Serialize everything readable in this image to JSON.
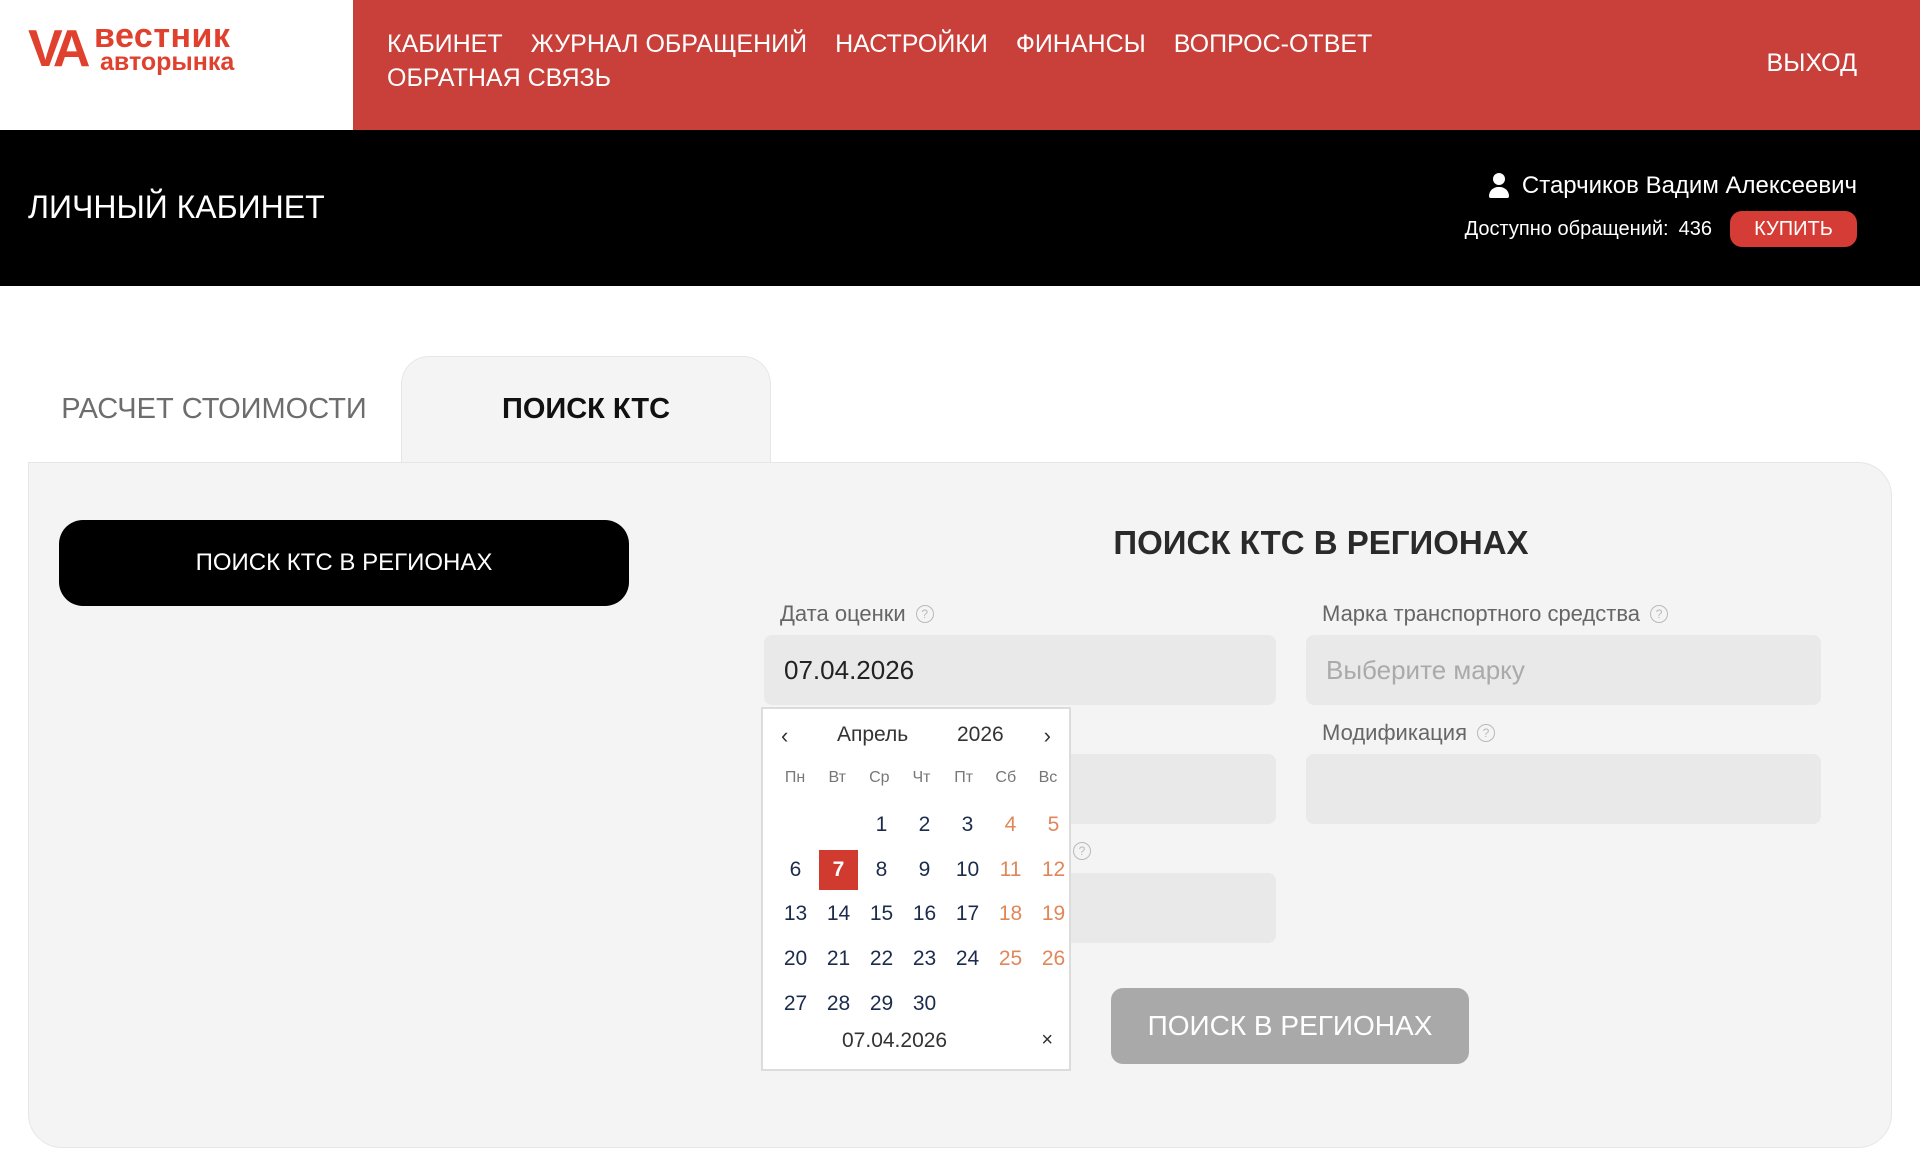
{
  "brand": {
    "mark": "VA",
    "line1": "вестник",
    "line2": "авторынка"
  },
  "nav": {
    "items": [
      "КАБИНЕТ",
      "ЖУРНАЛ ОБРАЩЕНИЙ",
      "НАСТРОЙКИ",
      "ФИНАНСЫ",
      "ВОПРОС-ОТВЕТ",
      "ОБРАТНАЯ СВЯЗЬ"
    ],
    "logout": "ВЫХОД"
  },
  "header": {
    "title": "ЛИЧНЫЙ КАБИНЕТ",
    "user_name": "Старчиков Вадим Алексеевич",
    "credits_label": "Доступно обращений:",
    "credits_count": "436",
    "buy_label": "КУПИТЬ"
  },
  "tabs": [
    {
      "label": "РАСЧЕТ СТОИМОСТИ",
      "active": false
    },
    {
      "label": "ПОИСК КТС",
      "active": true
    }
  ],
  "sidebar": {
    "button_label": "ПОИСК КТС В РЕГИОНАХ"
  },
  "form": {
    "title": "ПОИСК КТС В РЕГИОНАХ",
    "date_label": "Дата оценки",
    "date_value": "07.04.2026",
    "brand_label": "Марка транспортного средства",
    "brand_placeholder": "Выберите марку",
    "modification_label": "Модификация",
    "modification_value": "",
    "submit_label": "ПОИСК В РЕГИОНАХ",
    "help_glyph": "?"
  },
  "datepicker": {
    "prev": "‹",
    "next": "›",
    "month": "Апрель",
    "year": "2026",
    "weekdays": [
      "Пн",
      "Вт",
      "Ср",
      "Чт",
      "Пт",
      "Сб",
      "Вс"
    ],
    "leading_blanks": 2,
    "days": [
      "1",
      "2",
      "3",
      "4",
      "5",
      "6",
      "7",
      "8",
      "9",
      "10",
      "11",
      "12",
      "13",
      "14",
      "15",
      "16",
      "17",
      "18",
      "19",
      "20",
      "21",
      "22",
      "23",
      "24",
      "25",
      "26",
      "27",
      "28",
      "29",
      "30"
    ],
    "selected_day": "7",
    "footer_value": "07.04.2026",
    "clear": "×"
  },
  "colors": {
    "brand_red": "#c9403a",
    "accent_red": "#d03a2f",
    "weekend": "#e0875a",
    "header_black": "#000000",
    "panel_bg": "#f4f4f4"
  }
}
